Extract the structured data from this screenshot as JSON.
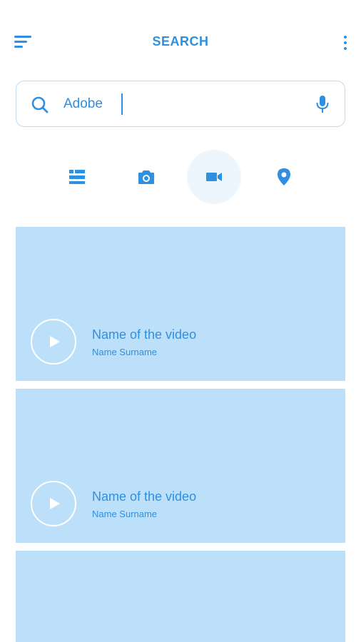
{
  "header": {
    "title": "SEARCH"
  },
  "search": {
    "value": "Adobe",
    "placeholder": ""
  },
  "filters": [
    {
      "name": "list-icon",
      "active": false
    },
    {
      "name": "camera-icon",
      "active": false
    },
    {
      "name": "video-camera-icon",
      "active": true
    },
    {
      "name": "location-pin-icon",
      "active": false
    }
  ],
  "results": [
    {
      "title": "Name of the video",
      "author": "Name Surname"
    },
    {
      "title": "Name of the video",
      "author": "Name Surname"
    }
  ],
  "colors": {
    "accent": "#2f8fe0",
    "card_bg": "#bde0fa",
    "active_filter_bg": "#edf5fd",
    "search_border": "#b9dcf8"
  }
}
